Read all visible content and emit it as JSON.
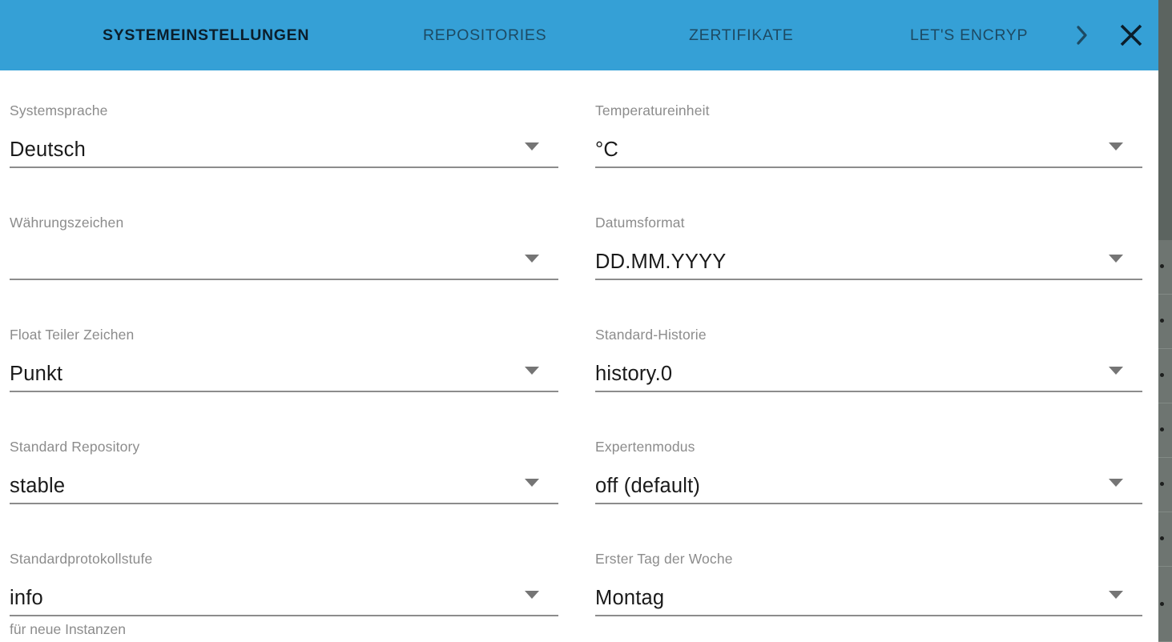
{
  "window": {
    "title": "Systemeinstellungen",
    "accent_color": "#35a0d6",
    "label_color": "#8c8c8c",
    "value_color": "#1a1a1a",
    "underline_color": "#8c8c8c"
  },
  "tabbar": {
    "tabs": [
      {
        "label": "SYSTEMEINSTELLUNGEN",
        "active": true
      },
      {
        "label": "REPOSITORIES",
        "active": false
      },
      {
        "label": "ZERTIFIKATE",
        "active": false
      },
      {
        "label": "LET'S ENCRYP",
        "active": false
      }
    ],
    "next_icon": "chevron-right-icon",
    "close_icon": "close-icon"
  },
  "form": {
    "left_column": [
      {
        "label": "Systemsprache",
        "value": "Deutsch",
        "hint": ""
      },
      {
        "label": "Währungszeichen",
        "value": "",
        "hint": ""
      },
      {
        "label": "Float Teiler Zeichen",
        "value": "Punkt",
        "hint": ""
      },
      {
        "label": "Standard Repository",
        "value": "stable",
        "hint": ""
      },
      {
        "label": "Standardprotokollstufe",
        "value": "info",
        "hint": "für neue Instanzen"
      }
    ],
    "right_column": [
      {
        "label": "Temperatureinheit",
        "value": "°C",
        "hint": ""
      },
      {
        "label": "Datumsformat",
        "value": "DD.MM.YYYY",
        "hint": ""
      },
      {
        "label": "Standard-Historie",
        "value": "history.0",
        "hint": ""
      },
      {
        "label": "Expertenmodus",
        "value": "off (default)",
        "hint": ""
      },
      {
        "label": "Erster Tag der Woche",
        "value": "Montag",
        "hint": ""
      }
    ]
  }
}
